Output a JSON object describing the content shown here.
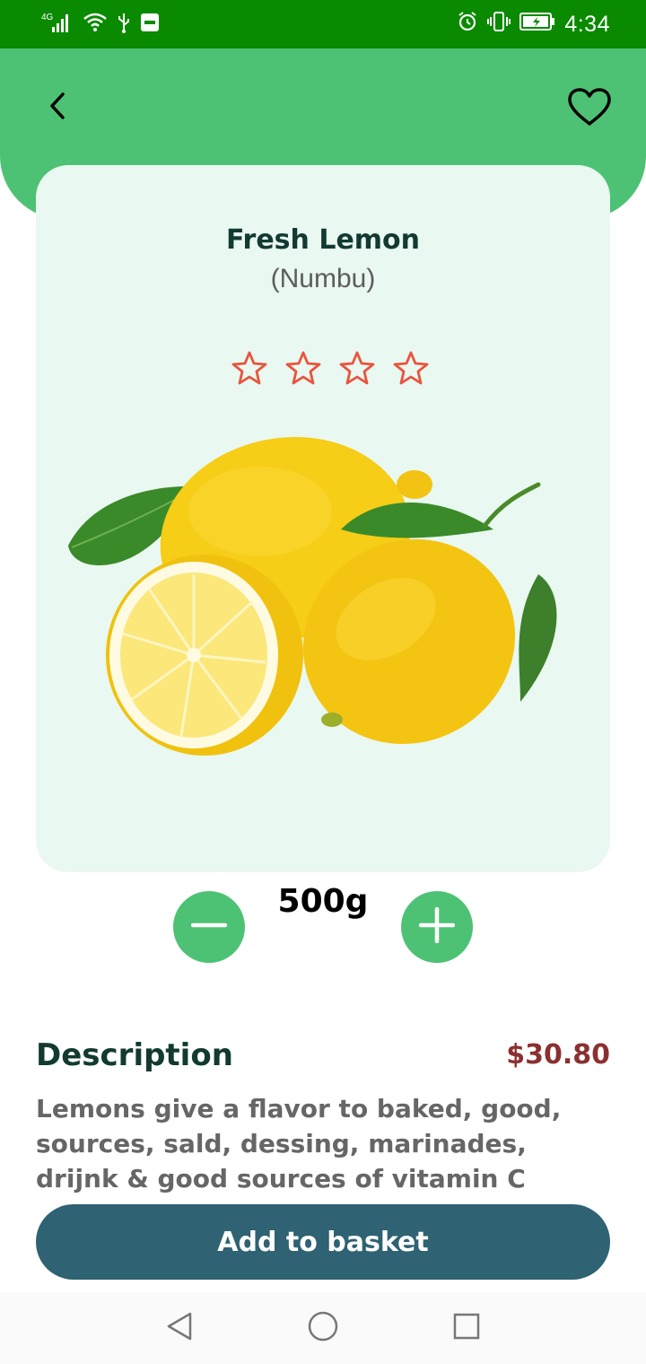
{
  "status_bar": {
    "network": "4G",
    "time": "4:34",
    "icons": [
      "signal-icon",
      "wifi-icon",
      "usb-icon",
      "sms-icon",
      "alarm-icon",
      "vibrate-icon",
      "battery-icon"
    ]
  },
  "header": {
    "back_icon": "chevron-left-icon",
    "favorite_icon": "heart-icon"
  },
  "product": {
    "name": "Fresh Lemon",
    "local_name": "(Numbu)",
    "rating": {
      "filled": 0,
      "total": 4
    },
    "image": "lemons-image"
  },
  "quantity": {
    "value": "500g",
    "decrement_icon": "minus-icon",
    "increment_icon": "plus-icon"
  },
  "description": {
    "title": "Description",
    "price": "$30.80",
    "lines": [
      "Lemons give a flavor to baked, good,",
      "sources, sald, dessing, marinades,",
      "drijnk & good sources of vitamin C"
    ]
  },
  "actions": {
    "add_to_basket": "Add to basket"
  },
  "nav_bar": {
    "icons": [
      "nav-back-icon",
      "nav-home-icon",
      "nav-recent-icon"
    ]
  },
  "colors": {
    "status_bar": "#0a8a00",
    "header": "#4dc274",
    "card": "#e9f8f0",
    "title": "#123a32",
    "price": "#8b3030",
    "star": "#e8543d",
    "button": "#2f6272"
  }
}
